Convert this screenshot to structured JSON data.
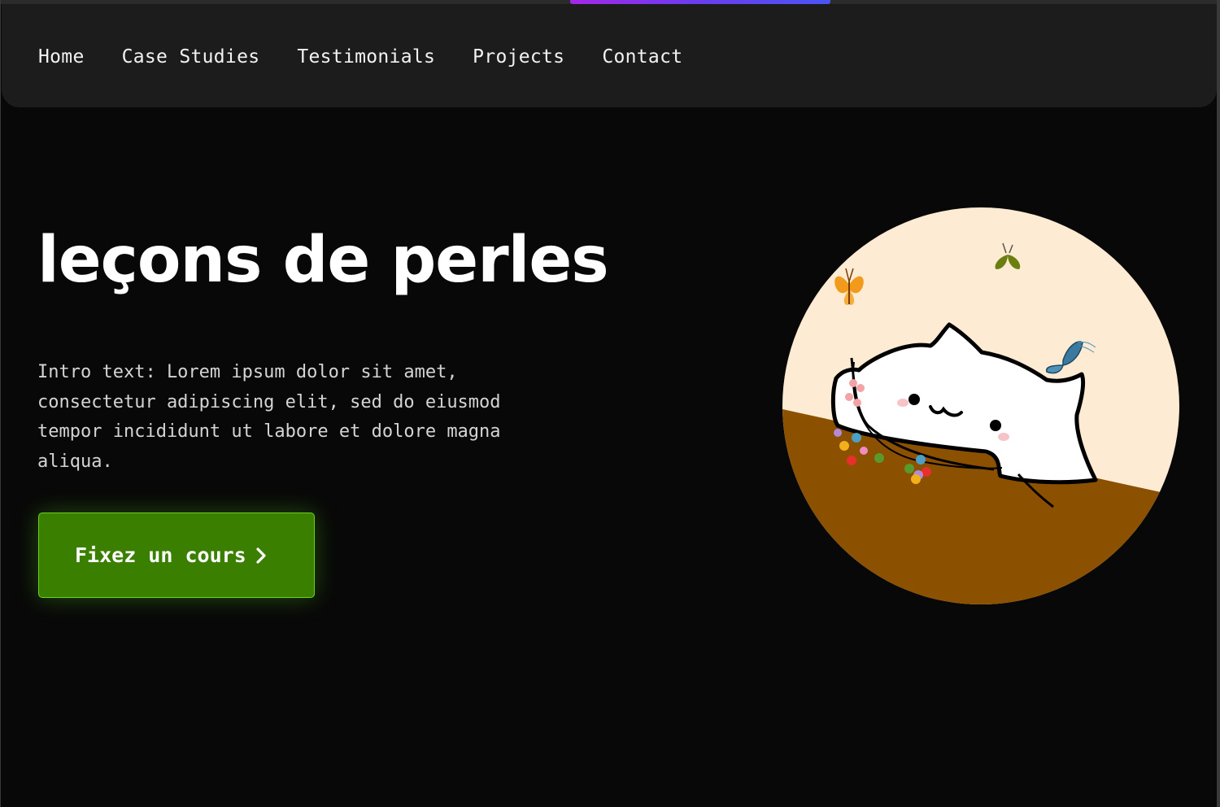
{
  "nav": {
    "items": [
      {
        "label": "Home"
      },
      {
        "label": "Case Studies"
      },
      {
        "label": "Testimonials"
      },
      {
        "label": "Projects"
      },
      {
        "label": "Contact"
      }
    ]
  },
  "progress": {
    "accent_start": "#a428e6",
    "accent_end": "#4b55f5"
  },
  "hero": {
    "title": "leçons de perles",
    "intro": "Intro text: Lorem ipsum dolor sit amet, consectetur adipiscing elit, sed do eiusmod tempor incididunt ut labore et dolore magna aliqua.",
    "cta": {
      "label": "Fixez un cours",
      "icon": "chevron-right-icon",
      "color": "#3a7f00"
    },
    "illustration": {
      "icon": "cat-beading-illustration",
      "background": "#fdebd3",
      "table_color": "#8b5000"
    }
  }
}
